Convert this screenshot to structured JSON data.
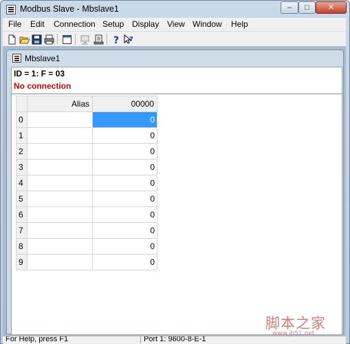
{
  "window": {
    "title": "Modbus Slave - Mbslave1"
  },
  "title_controls": {
    "minimize": "–",
    "maximize": "□",
    "close": "✕"
  },
  "menu": [
    "File",
    "Edit",
    "Connection",
    "Setup",
    "Display",
    "View",
    "Window",
    "Help"
  ],
  "toolbar": {
    "icons": [
      "new-icon",
      "open-icon",
      "save-icon",
      "print-icon",
      "window-icon",
      "disconnect-icon",
      "print-preview-icon",
      "help-icon",
      "context-help-icon"
    ]
  },
  "child_window": {
    "title": "Mbslave1",
    "id_line": "ID = 1: F = 03",
    "connection_status": "No connection"
  },
  "grid": {
    "columns": [
      "Alias",
      "00000"
    ],
    "rows": [
      {
        "index": "0",
        "alias": "",
        "value": "0"
      },
      {
        "index": "1",
        "alias": "",
        "value": "0"
      },
      {
        "index": "2",
        "alias": "",
        "value": "0"
      },
      {
        "index": "3",
        "alias": "",
        "value": "0"
      },
      {
        "index": "4",
        "alias": "",
        "value": "0"
      },
      {
        "index": "5",
        "alias": "",
        "value": "0"
      },
      {
        "index": "6",
        "alias": "",
        "value": "0"
      },
      {
        "index": "7",
        "alias": "",
        "value": "0"
      },
      {
        "index": "8",
        "alias": "",
        "value": "0"
      },
      {
        "index": "9",
        "alias": "",
        "value": "0"
      }
    ],
    "selected_row": 0
  },
  "statusbar": {
    "help": "For Help, press F1",
    "port": "Port 1: 9600-8-E-1"
  },
  "watermark": {
    "text": "脚本之家",
    "url": "www.jb51.net"
  },
  "colors": {
    "error": "#d00000",
    "selection": "#3399ff"
  }
}
